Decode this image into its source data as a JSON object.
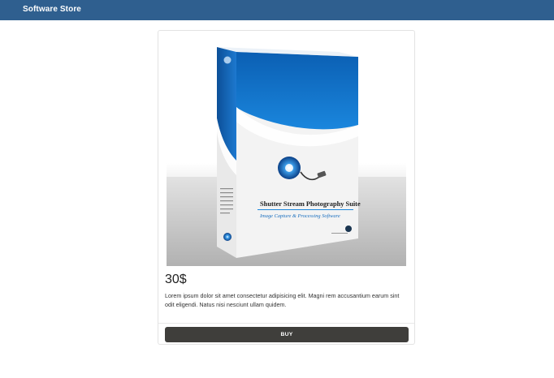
{
  "header": {
    "brand": "Software Store"
  },
  "product": {
    "box_title": "Shutter Stream Photography Suite",
    "box_subtitle": "Image Capture & Processing Software",
    "price": "30$",
    "description": "Lorem ipsum dolor sit amet consectetur adipisicing elit. Magni rem accusantium earum sint odit eligendi. Natus nisi nesciunt ullam quidem.",
    "buy_label": "BUY"
  },
  "colors": {
    "header_bg": "#2f5f8f",
    "button_bg": "#3f3e3b",
    "accent_blue": "#0a62b8"
  }
}
